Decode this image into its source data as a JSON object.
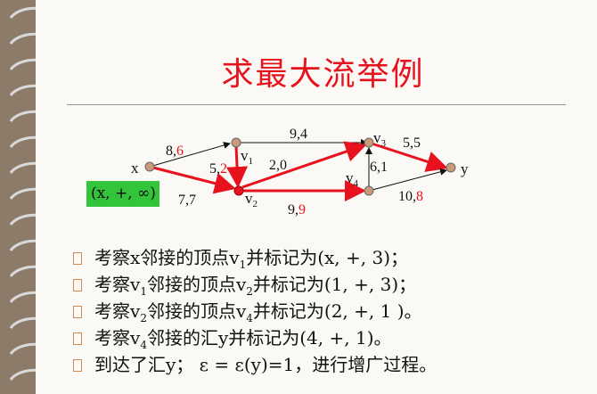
{
  "title": "求最大流举例",
  "graph": {
    "nodes": {
      "x": "x",
      "v1": "v",
      "v2": "v",
      "v3": "v",
      "v4": "v",
      "y": "y"
    },
    "node_subs": {
      "v1": "1",
      "v2": "2",
      "v3": "3",
      "v4": "4"
    },
    "edges": {
      "x_v1": {
        "cap": "8,",
        "flow": "6"
      },
      "x_v2": {
        "cap": "7,7",
        "flow": ""
      },
      "v1_v2": {
        "cap": "5,",
        "flow": "2"
      },
      "v1_v3": {
        "cap": "9,4",
        "flow": ""
      },
      "v4_v3": {
        "cap": "2,0",
        "flow": ""
      },
      "v3_y": {
        "cap": "5,5",
        "flow": ""
      },
      "v4_v3_side": {
        "cap": "6,1",
        "flow": ""
      },
      "v2_v4": {
        "cap": "9,",
        "flow": "9"
      },
      "v4_y": {
        "cap": "10,",
        "flow": "8"
      }
    },
    "source_label": "(x, +, ∞)"
  },
  "steps": [
    {
      "pre": "考察x邻接的顶点v",
      "sub": "1",
      "post": "并标记为(x, +, 3)；"
    },
    {
      "pre": "考察v",
      "sub": "1",
      "mid": "邻接的顶点v",
      "sub2": "2",
      "post": "并标记为(1, +, 3)；"
    },
    {
      "pre": "考察v",
      "sub": "2",
      "mid": "邻接的顶点v",
      "sub2": "4",
      "post": "并标记为(2, +, 1 )。"
    },
    {
      "pre": "考察v",
      "sub": "4",
      "post": "邻接的汇y并标记为(4, +, 1)。"
    },
    {
      "pre": "到达了汇y；  ε = ε(y)=1，进行增广过程。"
    }
  ],
  "colors": {
    "title": "#e8121e",
    "highlight": "#e8121e",
    "label_box": "#33c43b",
    "background": "#8d7b6a"
  }
}
